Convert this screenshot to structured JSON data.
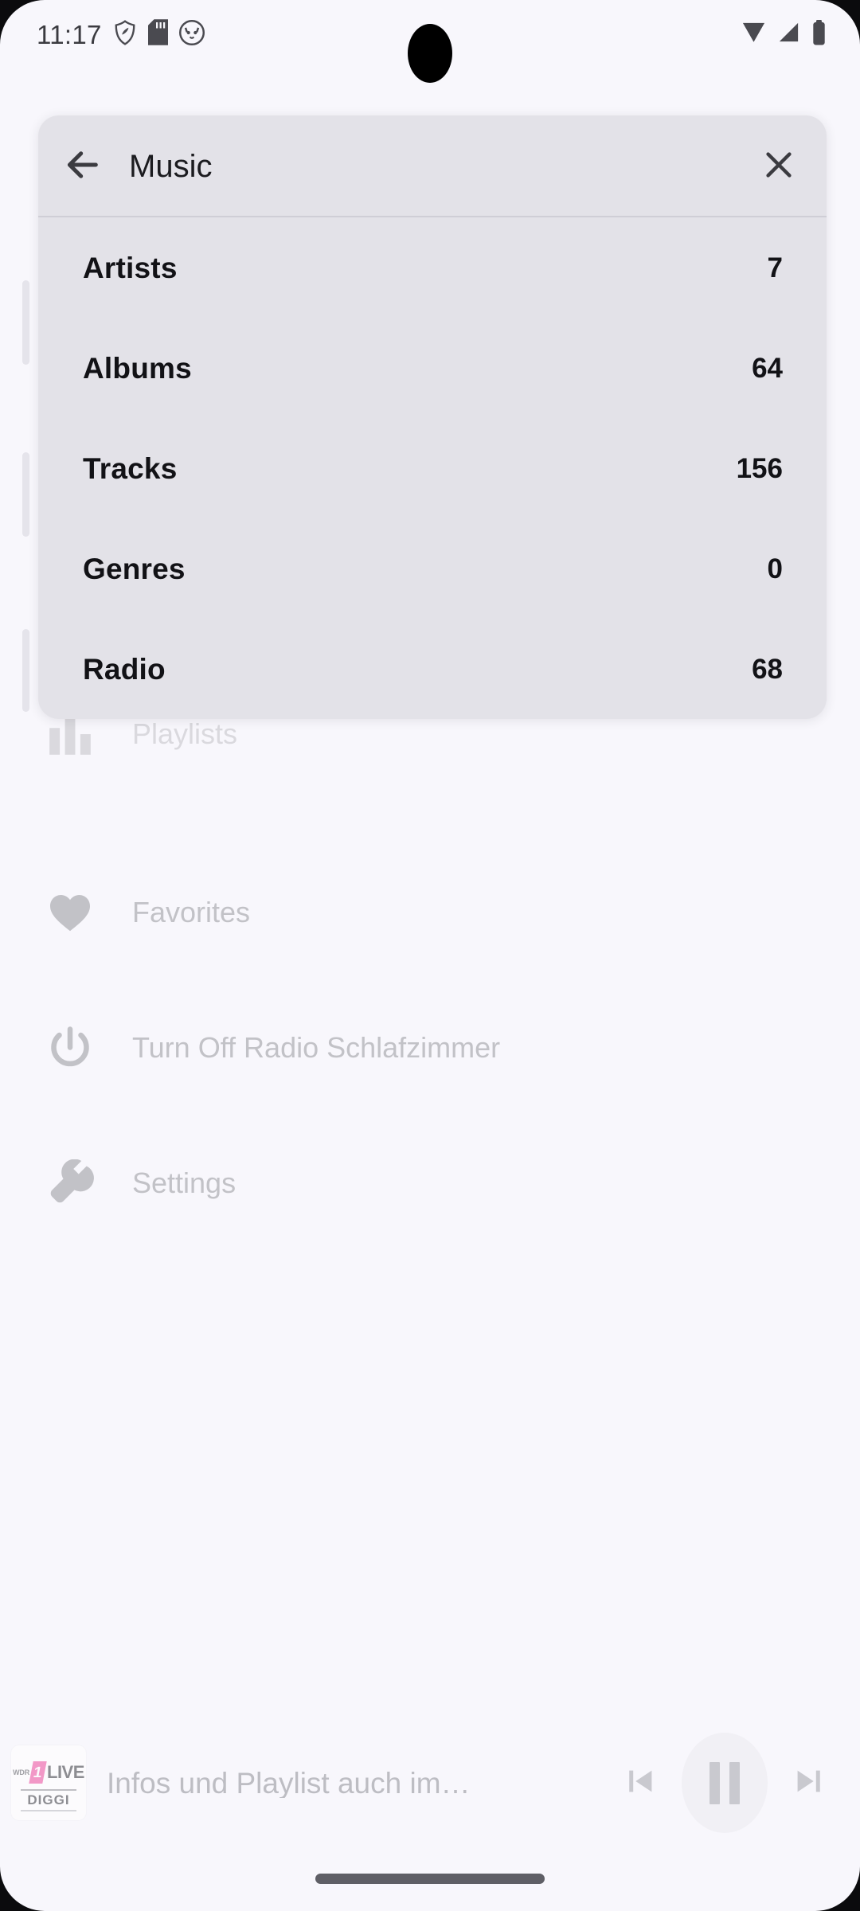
{
  "status_bar": {
    "time": "11:17",
    "left_icons": [
      "shield-icon",
      "sd-card-icon",
      "cat-avatar-icon"
    ],
    "right_icons": [
      "wifi-icon",
      "cellular-signal-icon",
      "battery-icon"
    ]
  },
  "dialog": {
    "title": "Music",
    "back_icon": "arrow-back-icon",
    "close_icon": "close-icon",
    "rows": [
      {
        "label": "Artists",
        "count": "7"
      },
      {
        "label": "Albums",
        "count": "64"
      },
      {
        "label": "Tracks",
        "count": "156"
      },
      {
        "label": "Genres",
        "count": "0"
      },
      {
        "label": "Radio",
        "count": "68"
      }
    ]
  },
  "background_drawer": {
    "items": [
      {
        "label": "Playlists",
        "icon": "equalizer-icon"
      },
      {
        "label": "Favorites",
        "icon": "heart-icon"
      },
      {
        "label": "Turn Off Radio Schlafzimmer",
        "icon": "power-icon"
      },
      {
        "label": "Settings",
        "icon": "wrench-icon"
      }
    ]
  },
  "player": {
    "album_art": {
      "wdr": "WDR",
      "one": "1",
      "live": "LIVE",
      "diggi": "DIGGI"
    },
    "track_title": "Infos und Playlist auch im…",
    "prev_label": "skip-previous",
    "play_state": "pause",
    "next_label": "skip-next"
  },
  "colors": {
    "page_background": "#F8F7FC",
    "dialog_background": "#E3E2E8",
    "dialog_divider": "#CFCED6",
    "primary_text": "#121216",
    "dimmed_text": "#C2C2C7",
    "accent_pink": "#EF5FA7",
    "gesture_bar": "#5F5F66"
  }
}
